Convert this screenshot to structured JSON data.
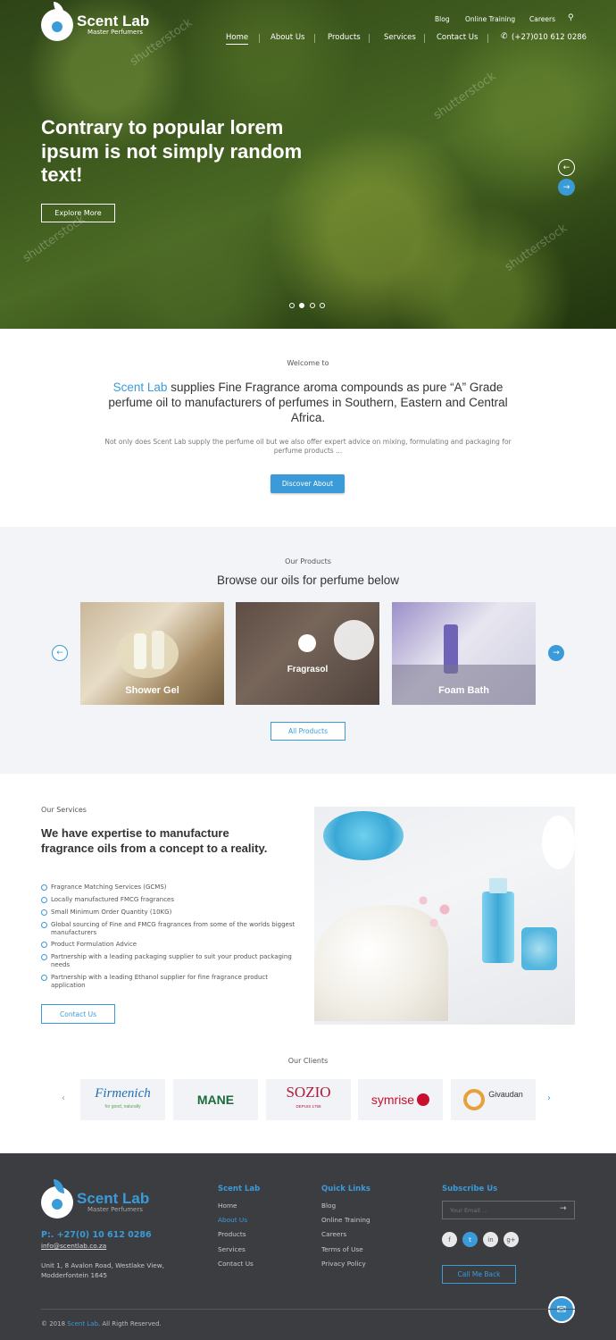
{
  "brand": {
    "name": "Scent Lab",
    "tagline": "Master Perfumers"
  },
  "top_nav": {
    "items": [
      "Blog",
      "Online Training",
      "Careers"
    ],
    "search_icon": "search-icon"
  },
  "main_nav": {
    "items": [
      "Home",
      "About Us",
      "Products",
      "Services",
      "Contact Us"
    ],
    "active": "Home",
    "phone": "(+27)010 612 0286"
  },
  "hero": {
    "title": "Contrary to popular lorem ipsum is not simply random text!",
    "button": "Explore More",
    "slides": 4,
    "active_slide": 2,
    "watermark": "shutterstock"
  },
  "welcome": {
    "eyebrow": "Welcome to",
    "heading_brand": "Scent Lab",
    "heading_rest": "supplies Fine Fragrance aroma compounds as pure “A” Grade perfume oil to manufacturers of perfumes in Southern, Eastern and Central Africa.",
    "body": "Not only does Scent Lab supply the perfume oil but we also offer expert advice on mixing, formulating and packaging for perfume products ...",
    "button": "Discover About"
  },
  "products": {
    "eyebrow": "Our Products",
    "heading": "Browse our oils for perfume below",
    "items": [
      "Shower Gel",
      "Fragrasol",
      "Foam Bath"
    ],
    "button": "All Products"
  },
  "services": {
    "eyebrow": "Our Services",
    "heading": "We have expertise to manufacture fragrance oils from a concept to a reality.",
    "items": [
      "Fragrance Matching Services (GCMS)",
      "Locally manufactured FMCG fragrances",
      "Small Minimum Order Quantity (10KG)",
      "Global sourcing of Fine and FMCG fragrances from some of the worlds biggest manufacturers",
      "Product Formulation Advice",
      "Partnership with a leading packaging supplier to suit your product packaging needs",
      "Partnership with a leading Ethanol supplier for fine fragrance product application"
    ],
    "button": "Contact Us"
  },
  "clients": {
    "eyebrow": "Our Clients",
    "logos": [
      {
        "name": "Firmenich",
        "sub": "for good, naturally",
        "color": "#1f6fb5"
      },
      {
        "name": "MANE",
        "color": "#1b6b3a"
      },
      {
        "name": "SOZIO",
        "sub": "DEPUIS 1758",
        "color": "#b0183a"
      },
      {
        "name": "symrise",
        "color": "#c8102e"
      },
      {
        "name": "Givaudan",
        "color": "#333333"
      }
    ]
  },
  "footer": {
    "phone": "P:. +27(0) 10 612 0286",
    "email": "info@scentlab.co.za",
    "address": "Unit 1, 8 Avalon Road, Westlake View, Modderfontein 1645",
    "col1_title": "Scent Lab",
    "col1_links": [
      "Home",
      "About Us",
      "Products",
      "Services",
      "Contact Us"
    ],
    "col2_title": "Quick Links",
    "col2_links": [
      "Blog",
      "Online Training",
      "Careers",
      "Terms of Use",
      "Privacy Policy"
    ],
    "subscribe_title": "Subscribe Us",
    "email_placeholder": "Your Email ...",
    "social": [
      "f",
      "t",
      "in",
      "g+"
    ],
    "call_button": "Call Me Back",
    "copyright_pre": "© 2018",
    "copyright_brand": "Scent Lab",
    "copyright_post": ". All Rigth Reserved."
  },
  "colors": {
    "accent": "#3a9bd8",
    "footer_bg": "#3c3d41",
    "products_bg": "#f3f4f8"
  }
}
